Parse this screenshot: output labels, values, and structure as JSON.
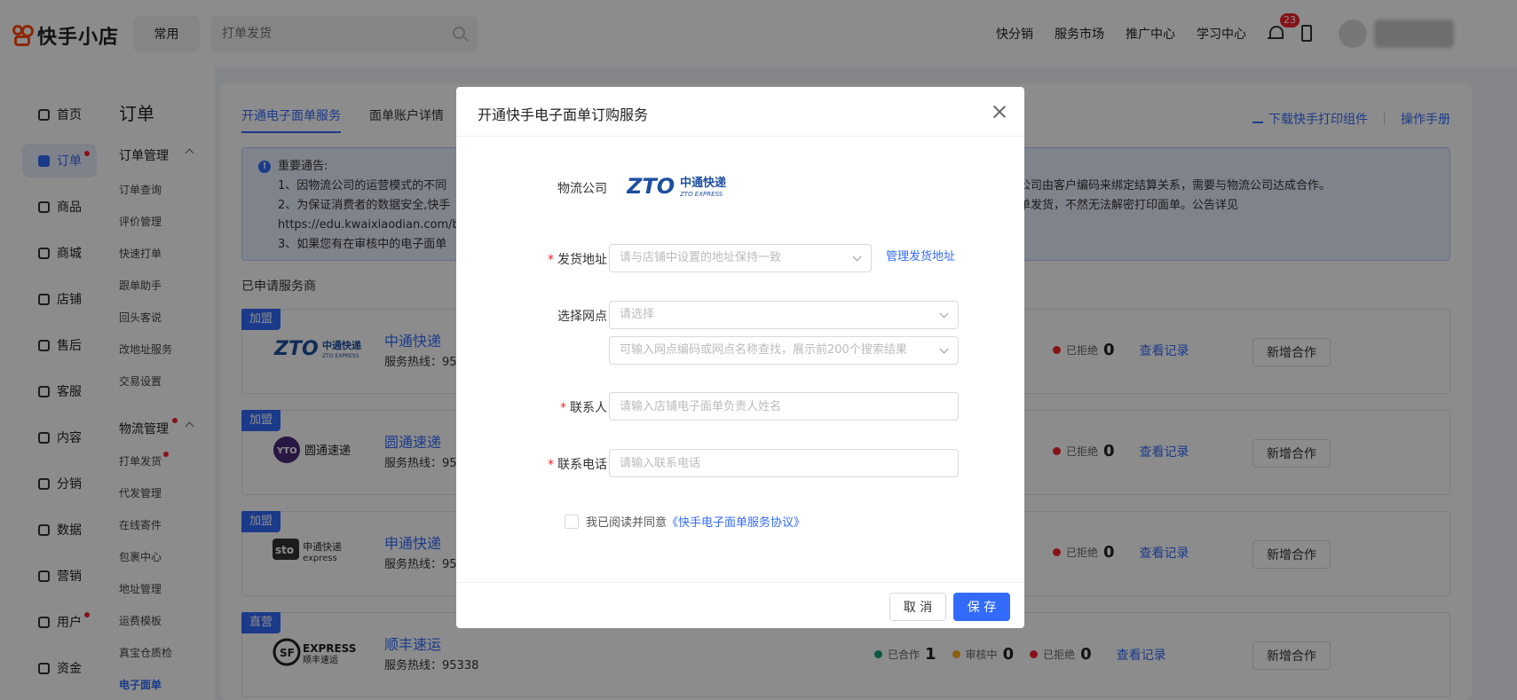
{
  "topbar": {
    "logo_text": "快手小店",
    "common_label": "常用",
    "search_placeholder": "打单发货",
    "nav": [
      "快分销",
      "服务市场",
      "推广中心",
      "学习中心"
    ],
    "notification_count": "23"
  },
  "sidebar": {
    "items": [
      {
        "label": "首页",
        "icon": "home-icon"
      },
      {
        "label": "订单",
        "icon": "order-icon"
      },
      {
        "label": "商品",
        "icon": "goods-icon"
      },
      {
        "label": "商城",
        "icon": "mall-icon"
      },
      {
        "label": "店铺",
        "icon": "shop-icon"
      },
      {
        "label": "售后",
        "icon": "aftersale-icon"
      },
      {
        "label": "客服",
        "icon": "service-icon"
      },
      {
        "label": "内容",
        "icon": "content-icon"
      },
      {
        "label": "分销",
        "icon": "distribution-icon"
      },
      {
        "label": "数据",
        "icon": "data-icon"
      },
      {
        "label": "营销",
        "icon": "marketing-icon"
      },
      {
        "label": "用户",
        "icon": "user-icon"
      },
      {
        "label": "资金",
        "icon": "funds-icon"
      }
    ]
  },
  "subnav": {
    "title": "订单",
    "group1": "订单管理",
    "group1_items": [
      "订单查询",
      "评价管理",
      "快速打单",
      "跟单助手",
      "回头客说",
      "改地址服务",
      "交易设置"
    ],
    "group2": "物流管理",
    "group2_items": [
      "打单发货",
      "代发管理",
      "在线寄件",
      "包裹中心",
      "地址管理",
      "运费模板",
      "真宝仓质检",
      "电子面单"
    ]
  },
  "main": {
    "tabs": [
      "开通电子面单服务",
      "面单账户详情"
    ],
    "download_link": "下载快手打印组件",
    "manual_link": "操作手册",
    "notice": {
      "title": "重要通告:",
      "line1": "1、因物流公司的运营模式的不同",
      "line1_right": "公司由客户编码来绑定结算关系，需要与物流公司达成合作。",
      "line2": "2、为保证消费者的数据安全,快手",
      "line2_right": "单发货，不然无法解密打印面单。公告详见",
      "line3": "https://edu.kwaixiaodian.com/bb",
      "line4": "3、如果您有在审核中的电子面单"
    },
    "applied_label": "已申请服务商",
    "rows": [
      {
        "tag": "加盟",
        "logo": "ZTO 中通快递",
        "name": "中通快递",
        "hotline": "服务热线：95",
        "rejected_label": "已拒绝",
        "rejected": "0",
        "record": "查看记录",
        "button": "新增合作"
      },
      {
        "tag": "加盟",
        "logo": "圆通速递",
        "name": "圆通速递",
        "hotline": "服务热线：95",
        "rejected_label": "已拒绝",
        "rejected": "0",
        "record": "查看记录",
        "button": "新增合作"
      },
      {
        "tag": "加盟",
        "logo": "sto 申通快递 express",
        "name": "申通快递",
        "hotline": "服务热线：95",
        "rejected_label": "已拒绝",
        "rejected": "0",
        "record": "查看记录",
        "button": "新增合作"
      },
      {
        "tag": "直营",
        "logo": "SF EXPRESS 顺丰速运",
        "name": "顺丰速运",
        "hotline": "服务热线：95338",
        "coop_label": "已合作",
        "coop": "1",
        "review_label": "审核中",
        "review": "0",
        "rejected_label": "已拒绝",
        "rejected": "0",
        "record": "查看记录",
        "button": "新增合作"
      }
    ]
  },
  "modal": {
    "title": "开通快手电子面单订购服务",
    "company_label": "物流公司",
    "company_logo": "ZTO 中通快递 ZTO EXPRESS",
    "address_label": "发货地址",
    "address_placeholder": "请与店铺中设置的地址保持一致",
    "manage_address": "管理发货地址",
    "branch_label": "选择网点",
    "branch_placeholder": "请选择",
    "branch_search_placeholder": "可输入网点编码或网点名称查找，展示前200个搜索结果",
    "contact_label": "联系人",
    "contact_placeholder": "请输入店铺电子面单负责人姓名",
    "phone_label": "联系电话",
    "phone_placeholder": "请输入联系电话",
    "agree_text": "我已阅读并同意",
    "agree_link": "《快手电子面单服务协议》",
    "cancel": "取 消",
    "save": "保 存"
  },
  "colors": {
    "primary": "#326bfb",
    "danger": "#f5222d",
    "success": "#12a37b",
    "warning": "#faad14"
  }
}
